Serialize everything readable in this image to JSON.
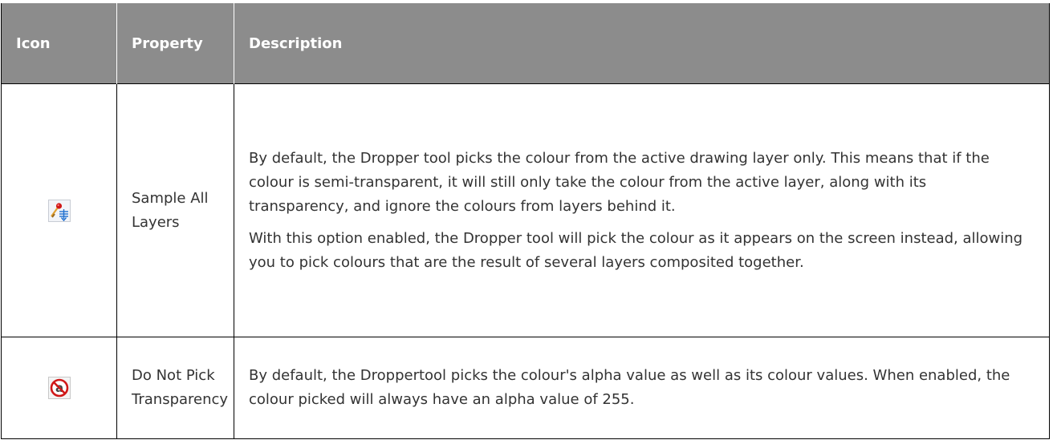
{
  "header": {
    "icon": "Icon",
    "property": "Property",
    "description": "Description"
  },
  "rows": [
    {
      "icon": "dropper-sample-all-layers-icon",
      "property": "Sample All Layers",
      "description": [
        "By default, the Dropper tool picks the colour from the active drawing layer only. This means that if the colour is semi-transparent, it will still only take the colour from the active layer, along with its transparency, and ignore the colours from layers behind it.",
        "With this option enabled, the Dropper tool will pick the colour as it appears on the screen instead, allowing you to pick colours that are the result of several layers composited together."
      ]
    },
    {
      "icon": "do-not-pick-transparency-icon",
      "property": "Do Not Pick Transparency",
      "description": [
        "By default, the Droppertool picks the colour's alpha value as well as its colour values. When enabled, the colour picked will always have an alpha value of 255."
      ]
    }
  ],
  "colors": {
    "header_bg": "#8c8c8c",
    "header_text": "#ffffff",
    "body_text": "#333333",
    "border": "#000000"
  }
}
